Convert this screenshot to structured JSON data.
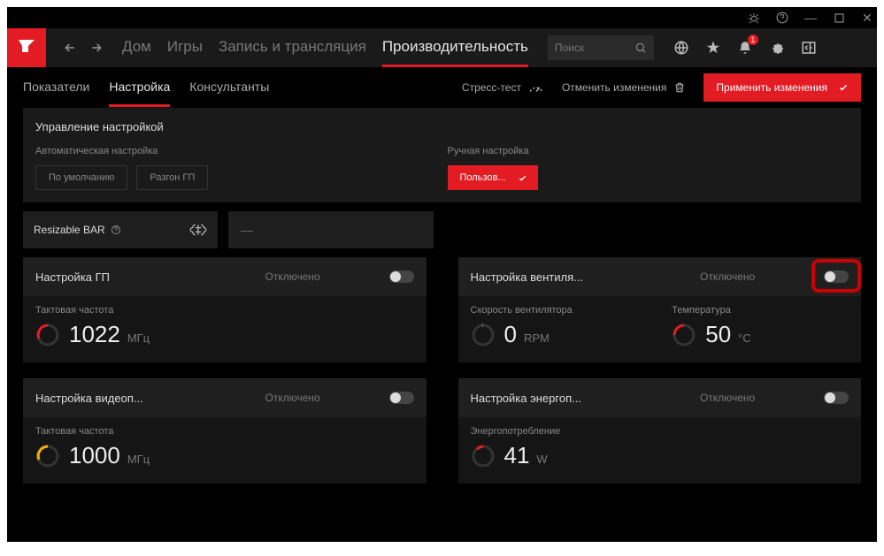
{
  "titlebar": {
    "min": "—",
    "max": "▢",
    "close": "✕"
  },
  "nav": {
    "tabs": [
      "Дом",
      "Игры",
      "Запись и трансляция",
      "Производительность"
    ],
    "active_index": 3,
    "search_placeholder": "Поиск",
    "notification_count": "1"
  },
  "subnav": {
    "tabs": [
      "Показатели",
      "Настройка",
      "Консультанты"
    ],
    "active_index": 1,
    "stress_label": "Стресс-тест",
    "discard_label": "Отменить изменения",
    "apply_label": "Применить изменения"
  },
  "control": {
    "header": "Управление настройкой",
    "auto_label": "Автоматическая настройка",
    "auto_buttons": [
      "По умолчанию",
      "Разгон ГП"
    ],
    "manual_label": "Ручная настройка",
    "manual_button": "Пользов..."
  },
  "rbar": {
    "label": "Resizable BAR",
    "value": "—"
  },
  "cards": {
    "gpu": {
      "title": "Настройка ГП",
      "status": "Отключено",
      "metric_label": "Тактовая частота",
      "value": "1022",
      "unit": "МГц"
    },
    "fan": {
      "title": "Настройка вентиля...",
      "status": "Отключено",
      "metric1_label": "Скорость вентилятора",
      "metric1_value": "0",
      "metric1_unit": "RPM",
      "metric2_label": "Температура",
      "metric2_value": "50",
      "metric2_unit": "°C"
    },
    "vram": {
      "title": "Настройка видеоп...",
      "status": "Отключено",
      "metric_label": "Тактовая частота",
      "value": "1000",
      "unit": "МГц"
    },
    "power": {
      "title": "Настройка энергоп...",
      "status": "Отключено",
      "metric_label": "Энергопотребление",
      "value": "41",
      "unit": "W"
    }
  }
}
